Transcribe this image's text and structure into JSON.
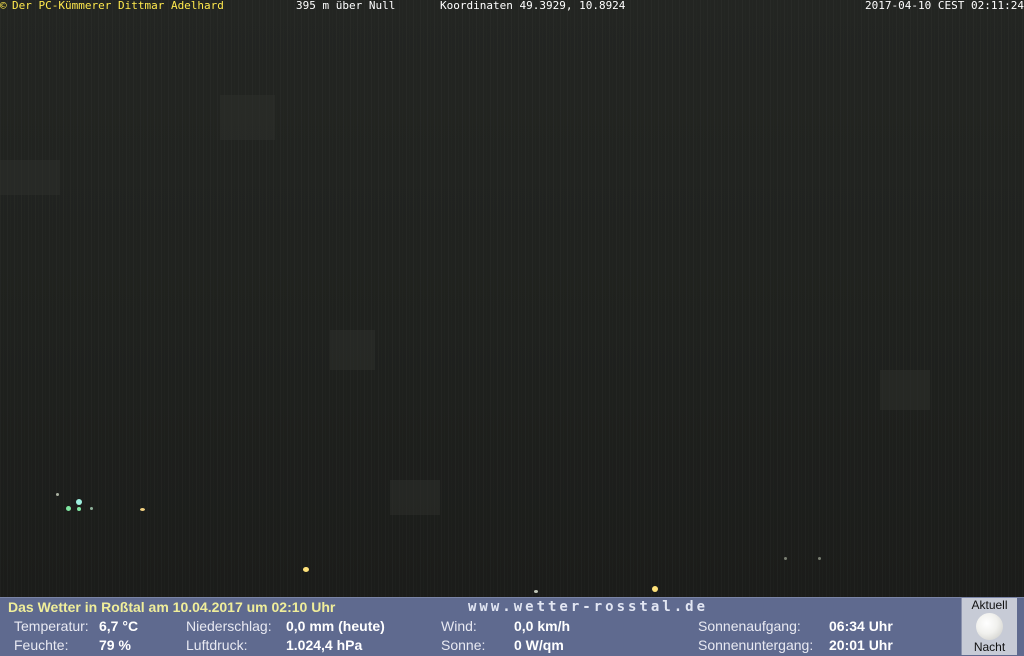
{
  "overlay": {
    "copyright_icon": "copyright-icon",
    "owner": "Der PC-Kümmerer Dittmar Adelhard",
    "altitude": "395 m über Null",
    "coordinates": "Koordinaten 49.3929, 10.8924",
    "timestamp": "2017-04-10 CEST 02:11:24"
  },
  "panel": {
    "headline": "Das Wetter in Roßtal am 10.04.2017 um 02:10 Uhr",
    "website": "www.wetter-rosstal.de",
    "temperature": {
      "label": "Temperatur:",
      "value": "6,7 °C"
    },
    "humidity": {
      "label": "Feuchte:",
      "value": "79 %"
    },
    "precipitation": {
      "label": "Niederschlag:",
      "value": "0,0 mm (heute)"
    },
    "pressure": {
      "label": "Luftdruck:",
      "value": "1.024,4 hPa"
    },
    "wind": {
      "label": "Wind:",
      "value": "0,0 km/h"
    },
    "sun": {
      "label": "Sonne:",
      "value": "0 W/qm"
    },
    "sunrise": {
      "label": "Sonnenaufgang:",
      "value": "06:34 Uhr"
    },
    "sunset": {
      "label": "Sonnenuntergang:",
      "value": "20:01 Uhr"
    },
    "moon": {
      "top_label": "Aktuell",
      "bottom_label": "Nacht",
      "icon": "full-moon-icon"
    }
  },
  "colors": {
    "overlay_yellow": "#ffe94d",
    "panel_bg": "#5f6a8f",
    "headline": "#f0ee9a"
  }
}
